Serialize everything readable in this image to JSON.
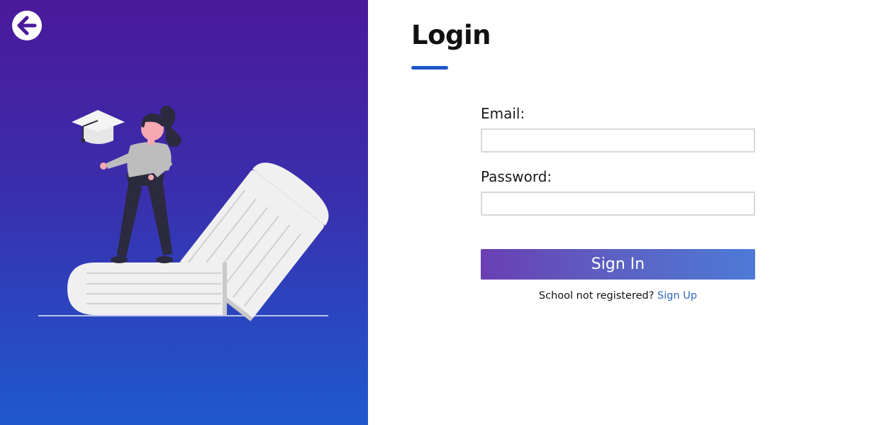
{
  "back": {
    "icon": "arrow-left-icon",
    "color": "#4b199c"
  },
  "illustration": {
    "icon": "graduate-on-books-illustration"
  },
  "login": {
    "title": "Login",
    "accent_color": "#1f56c6"
  },
  "form": {
    "email_label": "Email:",
    "email_value": "",
    "email_placeholder": "",
    "password_label": "Password:",
    "password_value": "",
    "password_placeholder": "",
    "submit_label": "Sign In"
  },
  "signup": {
    "prompt": "School not registered?",
    "link_label": "Sign Up",
    "link_color": "#2f67c3"
  },
  "colors": {
    "panel_gradient_top": "#4b199c",
    "panel_gradient_bottom": "#1f59cc",
    "button_gradient_start": "#6a3fb3",
    "button_gradient_end": "#4d7ad6"
  }
}
